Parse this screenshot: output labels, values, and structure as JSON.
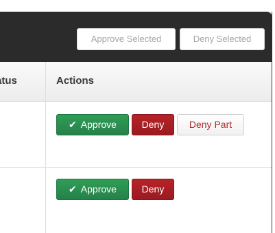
{
  "toolbar": {
    "approve_selected_label": "Approve Selected",
    "deny_selected_label": "Deny Selected"
  },
  "table": {
    "columns": {
      "status": "atus",
      "actions": "Actions"
    },
    "rows": [
      {
        "approve_label": "Approve",
        "deny_label": "Deny",
        "deny_part_label": "Deny Part"
      },
      {
        "approve_label": "Approve",
        "deny_label": "Deny"
      }
    ]
  },
  "icons": {
    "approve": "check-icon"
  },
  "colors": {
    "header_bg": "#2b2b2b",
    "approve_green": "#2a8f4e",
    "deny_red": "#a91f24",
    "deny_part_text": "#b22b2b",
    "disabled_text": "#a6a6a6"
  }
}
